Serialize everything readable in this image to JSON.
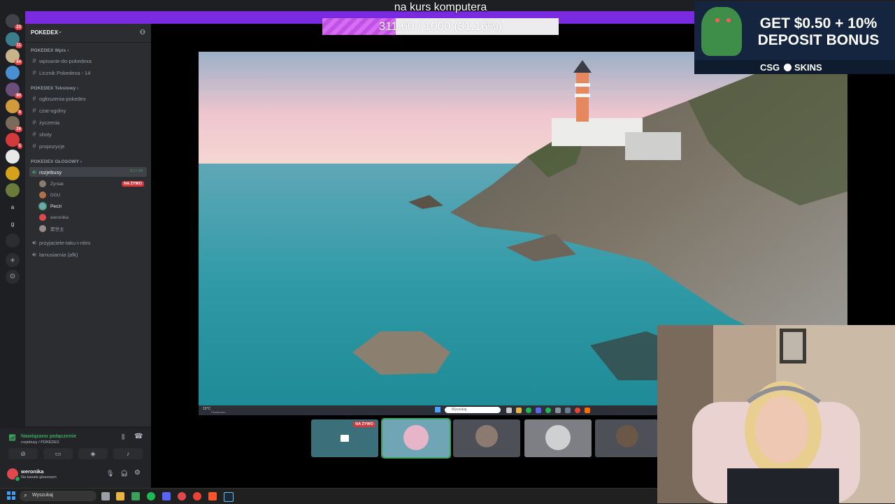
{
  "stream_overlay": {
    "goal_title": "na kurs komputera",
    "goal_progress_text": "311.60 / 1000 (31.16%)",
    "goal_progress_fraction": 0.3116,
    "accent_color": "#7a2be2"
  },
  "ad_banner": {
    "headline_line1": "GET $0.50 + 10%",
    "headline_line2": "DEPOSIT BONUS",
    "brand": "CSG",
    "brand_suffix": "SKINS"
  },
  "server_rail": {
    "badges": [
      "23",
      "11",
      "64",
      "80",
      "8",
      "26",
      "5"
    ],
    "letters": [
      "a",
      "g"
    ]
  },
  "guild": {
    "name": "POKEDEX",
    "categories": [
      {
        "name": "POKEDEX Wpis",
        "channels": [
          "wpisanie-do-pokedexa",
          "Licznik Pokedexa - 14"
        ]
      },
      {
        "name": "POKEDEX Tekstowy",
        "channels": [
          "ogłoszenia-pokedex",
          "czat-ogólny",
          "życzenia",
          "shoty",
          "propozycje"
        ]
      },
      {
        "name": "POKEDEX GŁOSOWY",
        "channels": []
      }
    ],
    "voice_channel": {
      "name": "rozjebusy",
      "timer": "3:17:24",
      "live_badge": "NA ŻYWO",
      "users": [
        "Żyniak",
        "DGU",
        "Peczi",
        "weronika",
        "窦世主"
      ]
    },
    "other_voice_channels": [
      "przyjaciele-taku-i-nitro",
      "lamusiarnia (afk)"
    ]
  },
  "voice_panel": {
    "status": "Nawiązano połączenie",
    "location": "rozjebusy / POKEDEX"
  },
  "user_panel": {
    "username": "weronika",
    "status": "Na kanale głosowym"
  },
  "stream": {
    "thumbnail_live_badge": "NA ŻYWO",
    "remote_search_placeholder": "Wyszukaj",
    "remote_weather": "10°C",
    "remote_weather_desc": "Pochmurno"
  },
  "taskbar": {
    "search_placeholder": "Wyszukaj"
  }
}
